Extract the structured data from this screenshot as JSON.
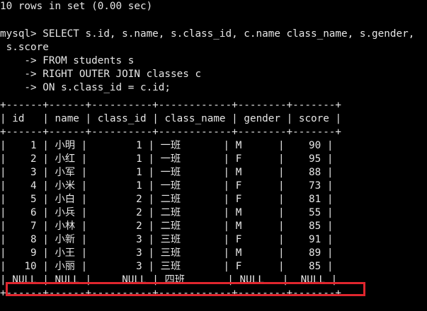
{
  "terminal": {
    "result_summary": "10 rows in set (0.00 sec)",
    "query_lines": [
      "mysql> SELECT s.id, s.name, s.class_id, c.name class_name, s.gender,",
      " s.score",
      "    -> FROM students s",
      "    -> RIGHT OUTER JOIN classes c",
      "    -> ON s.class_id = c.id;"
    ]
  },
  "table": {
    "columns": [
      "id",
      "name",
      "class_id",
      "class_name",
      "gender",
      "score"
    ],
    "rows": [
      [
        "1",
        "小明",
        "1",
        "一班",
        "M",
        "90"
      ],
      [
        "2",
        "小红",
        "1",
        "一班",
        "F",
        "95"
      ],
      [
        "3",
        "小军",
        "1",
        "一班",
        "M",
        "88"
      ],
      [
        "4",
        "小米",
        "1",
        "一班",
        "F",
        "73"
      ],
      [
        "5",
        "小白",
        "2",
        "二班",
        "F",
        "81"
      ],
      [
        "6",
        "小兵",
        "2",
        "二班",
        "M",
        "55"
      ],
      [
        "7",
        "小林",
        "2",
        "二班",
        "M",
        "85"
      ],
      [
        "8",
        "小新",
        "3",
        "三班",
        "F",
        "91"
      ],
      [
        "9",
        "小王",
        "3",
        "三班",
        "M",
        "89"
      ],
      [
        "10",
        "小丽",
        "3",
        "三班",
        "F",
        "85"
      ],
      [
        "NULL",
        "NULL",
        "NULL",
        "四班",
        "NULL",
        "NULL"
      ]
    ]
  },
  "colors": {
    "background": "#000000",
    "text": "#e6e6e6",
    "highlight_box": "#e0262e"
  }
}
